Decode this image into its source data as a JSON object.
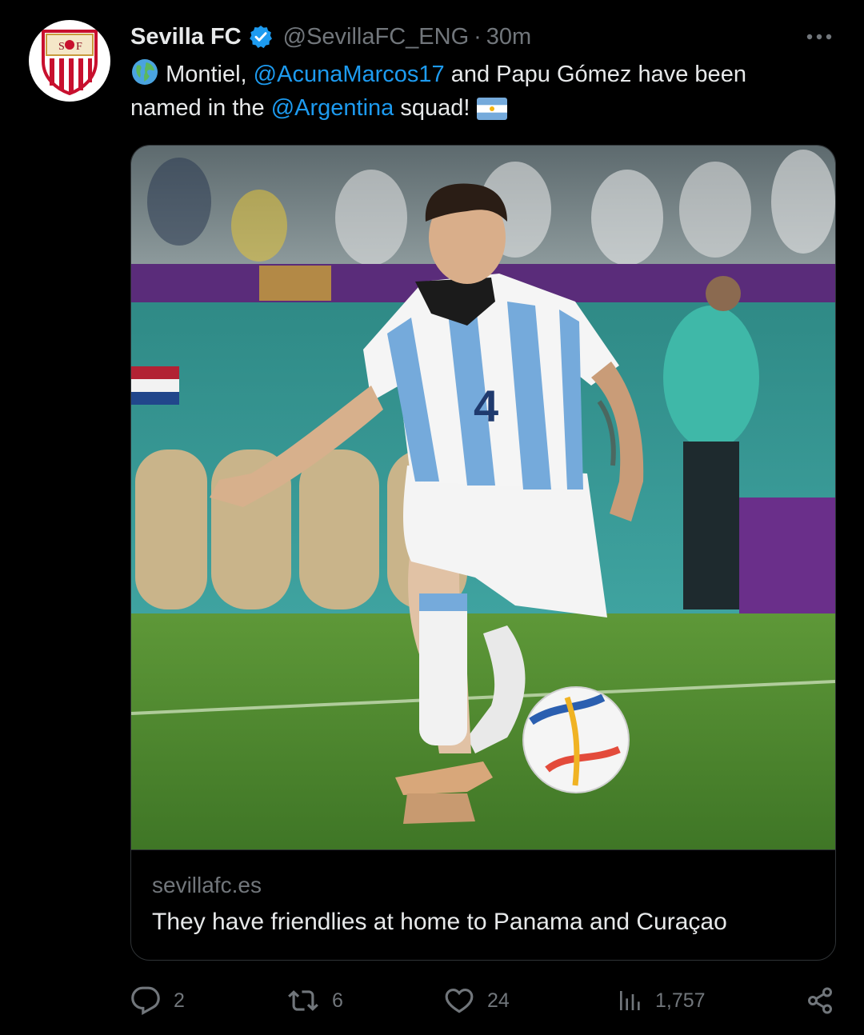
{
  "tweet": {
    "author_name": "Sevilla FC",
    "handle": "@SevillaFC_ENG",
    "separator": "·",
    "time": "30m",
    "text_part1": "Montiel,",
    "mention1": "@AcunaMarcos17",
    "text_part2": "and Papu Gómez have been named in the",
    "mention2": "@Argentina",
    "text_part3": "squad!",
    "icons": [
      "globe-icon",
      "argentina-flag-icon",
      "verified-badge-icon",
      "more-options-icon"
    ]
  },
  "card": {
    "domain": "sevillafc.es",
    "title": "They have friendlies at home to Panama and Curaçao"
  },
  "actions": {
    "replies": "2",
    "retweets": "6",
    "likes": "24",
    "views": "1,757"
  },
  "colors": {
    "background": "#000000",
    "text": "#e7e9ea",
    "secondary": "#71767b",
    "link": "#1d9bf0",
    "border": "#2f3336",
    "argentina_blue": "#75aadb",
    "pitch_green": "#4f8a2c"
  }
}
